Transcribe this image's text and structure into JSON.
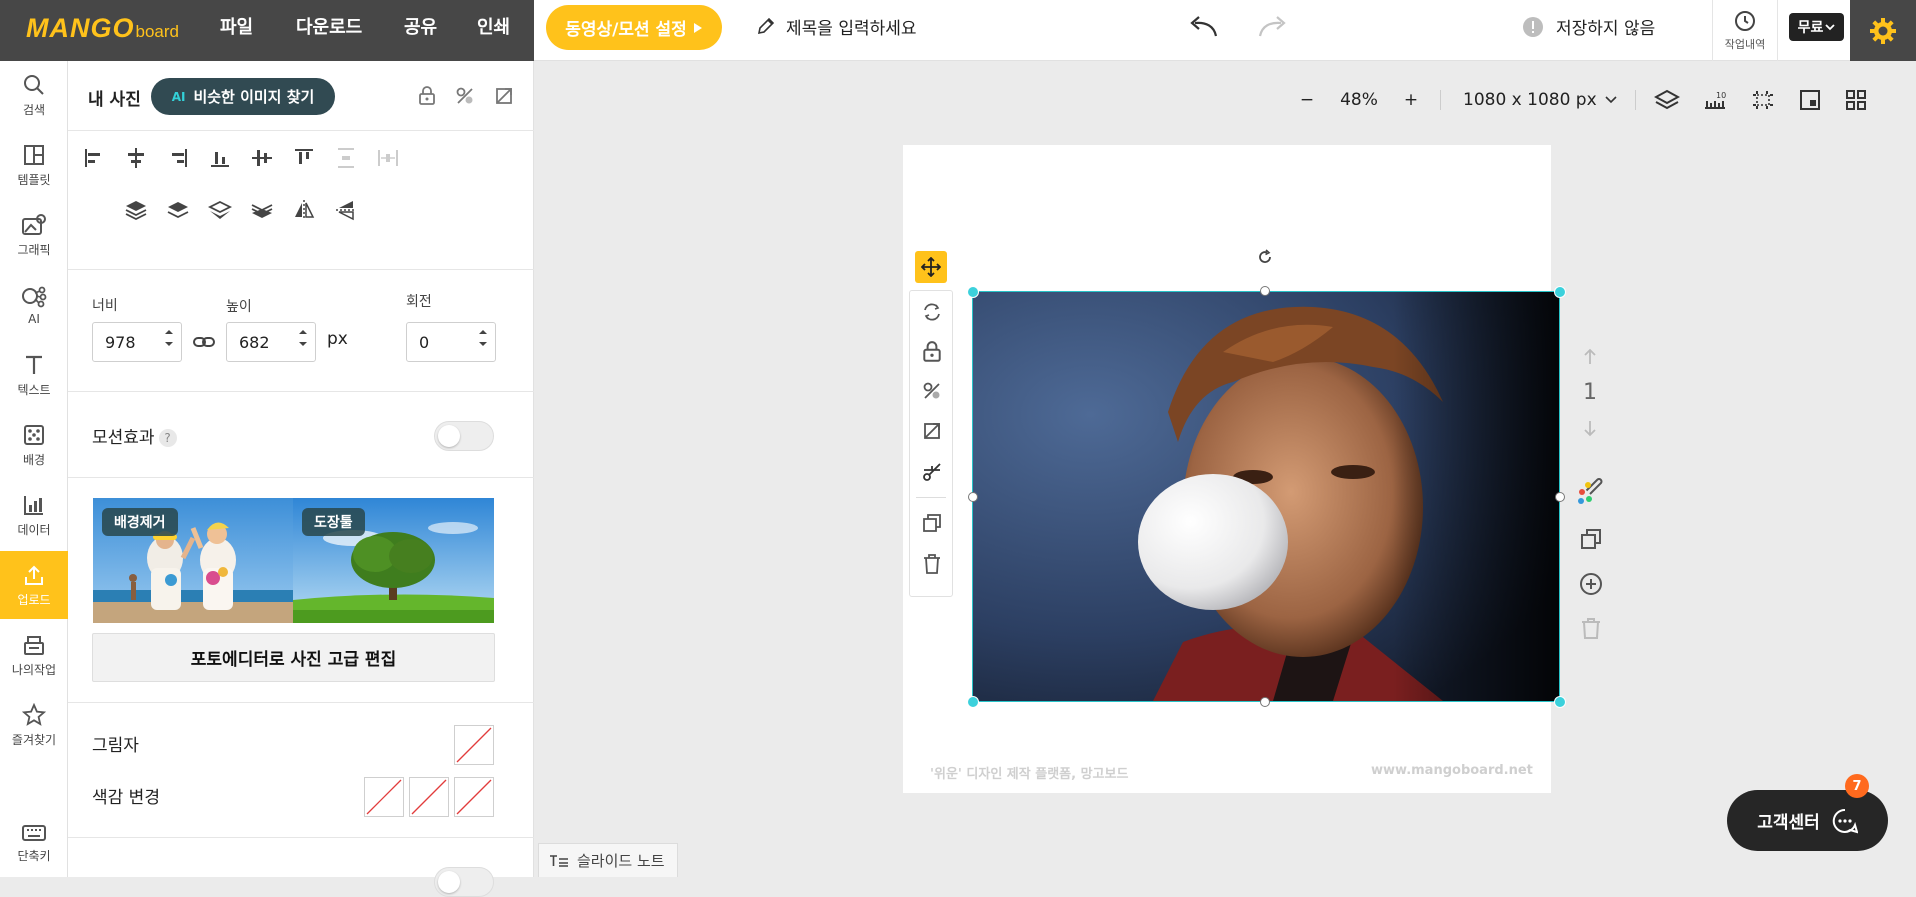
{
  "brand": {
    "logo_main": "MANGO",
    "logo_sub": "board"
  },
  "menu": [
    {
      "label": "파일"
    },
    {
      "label": "다운로드"
    },
    {
      "label": "공유"
    },
    {
      "label": "인쇄"
    }
  ],
  "video_button": {
    "label": "동영상/모션 설정"
  },
  "title": {
    "placeholder": "제목을 입력하세요"
  },
  "save_status": "저장하지 않음",
  "history_label": "작업내역",
  "plan_label": "무료",
  "rail": [
    {
      "label": "검색",
      "icon": "search-icon"
    },
    {
      "label": "템플릿",
      "icon": "template-icon"
    },
    {
      "label": "그래픽",
      "icon": "graphic-icon"
    },
    {
      "label": "AI",
      "icon": "ai-icon"
    },
    {
      "label": "텍스트",
      "icon": "text-icon"
    },
    {
      "label": "배경",
      "icon": "background-icon"
    },
    {
      "label": "데이터",
      "icon": "chart-icon"
    },
    {
      "label": "업로드",
      "icon": "upload-icon",
      "active": true
    },
    {
      "label": "나의작업",
      "icon": "my-work-icon"
    },
    {
      "label": "즐겨찾기",
      "icon": "star-icon"
    },
    {
      "label": "단축키",
      "icon": "keyboard-icon"
    }
  ],
  "panel": {
    "title": "내 사진",
    "similar_button": "비슷한 이미지 찾기",
    "similar_badge": "AI",
    "width_label": "너비",
    "height_label": "높이",
    "rotation_label": "회전",
    "width_value": "978",
    "height_value": "682",
    "unit": "px",
    "rotation_value": "0",
    "motion_label": "모션효과",
    "help_mark": "?",
    "promo_bg_removal": "배경제거",
    "promo_stamp": "도장툴",
    "photo_editor_button": "포토에디터로 사진 고급 편집",
    "shadow_label": "그림자",
    "color_change_label": "색감 변경"
  },
  "workspace": {
    "zoom_minus": "−",
    "zoom_value": "48%",
    "zoom_plus": "+",
    "canvas_size": "1080 x 1080 px",
    "page_number": "1",
    "watermark_left": "'위운' 디자인 제작 플랫폼, 망고보드",
    "watermark_right": "www.mangoboard.net",
    "slide_note": "슬라이드 노트",
    "help_center": "고객센터",
    "notification_count": "7"
  },
  "colors": {
    "accent": "#ffc21b",
    "dark": "#474747",
    "selection": "#27c3c8",
    "button_teal": "#314a52"
  }
}
